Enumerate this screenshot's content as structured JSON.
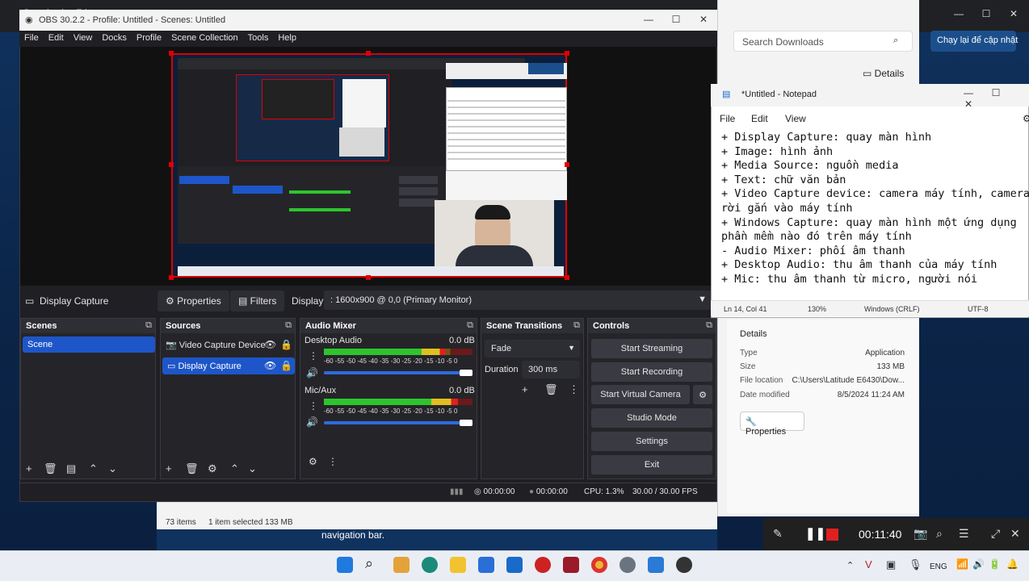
{
  "browser": {
    "tab_label": "Downloads - Edge",
    "minimize": "—",
    "maximize": "☐",
    "close": "✕"
  },
  "downloads": {
    "search_placeholder": "Search Downloads",
    "update_button": "Chạy lại để cập nhật",
    "details_toggle": "Details",
    "details_title": "Details",
    "rows": [
      {
        "key": "Type",
        "value": "Application"
      },
      {
        "key": "Size",
        "value": "133 MB"
      },
      {
        "key": "File location",
        "value": "C:\\Users\\Latitude E6430\\Dow..."
      },
      {
        "key": "Date modified",
        "value": "8/5/2024 11:24 AM"
      }
    ],
    "properties_button": "Properties"
  },
  "explorer": {
    "items_count": "73 items",
    "selection": "1 item selected  133 MB",
    "navigation_text": "navigation bar."
  },
  "obs": {
    "title": "OBS 30.2.2 - Profile: Untitled - Scenes: Untitled",
    "menu": [
      "File",
      "Edit",
      "View",
      "Docks",
      "Profile",
      "Scene Collection",
      "Tools",
      "Help"
    ],
    "source_bar": {
      "source_name": "Display Capture",
      "properties": "Properties",
      "filters": "Filters",
      "display_label": "Display",
      "display_value": ": 1600x900 @ 0,0 (Primary Monitor)"
    },
    "scenes": {
      "title": "Scenes",
      "items": [
        "Scene"
      ]
    },
    "sources": {
      "title": "Sources",
      "items": [
        "Video Capture Device",
        "Display Capture"
      ]
    },
    "audio_mixer": {
      "title": "Audio Mixer",
      "channels": [
        {
          "name": "Desktop Audio",
          "db": "0.0 dB",
          "level": 0.82,
          "volume": 1.0
        },
        {
          "name": "Mic/Aux",
          "db": "0.0 dB",
          "level": 0.9,
          "volume": 1.0
        }
      ],
      "scale": "-60 -55 -50 -45 -40 -35 -30 -25 -20 -15 -10 -5 0"
    },
    "transitions": {
      "title": "Scene Transitions",
      "type": "Fade",
      "duration_label": "Duration",
      "duration_value": "300 ms"
    },
    "controls": {
      "title": "Controls",
      "start_streaming": "Start Streaming",
      "start_recording": "Start Recording",
      "start_virtual_camera": "Start Virtual Camera",
      "studio_mode": "Studio Mode",
      "settings": "Settings",
      "exit": "Exit"
    },
    "status": {
      "stream_time": "00:00:00",
      "record_time": "00:00:00",
      "cpu": "CPU: 1.3%",
      "fps": "30.00 / 30.00 FPS"
    }
  },
  "notepad": {
    "title": "*Untitled - Notepad",
    "menu": [
      "File",
      "Edit",
      "View"
    ],
    "lines": [
      "+ Display Capture: quay màn hình",
      "+ Image: hình ảnh",
      "+ Media Source: nguồn media",
      "+ Text: chữ văn bản",
      "+ Video Capture device: camera máy tính, camera",
      "rời gắn vào máy tính",
      "+ Windows Capture: quay màn hình một ứng dụng",
      "phần mềm nào đó trên máy tính",
      "- Audio Mixer: phối âm thanh",
      "+ Desktop Audio: thu âm thanh của máy tính",
      "+ Mic: thu âm thanh từ micro, người nói"
    ],
    "status": {
      "position": "Ln 14, Col 41",
      "zoom": "130%",
      "line_ending": "Windows (CRLF)",
      "encoding": "UTF-8"
    }
  },
  "recorder": {
    "time": "00:11:40"
  },
  "taskbar": {
    "language": "ENG"
  }
}
